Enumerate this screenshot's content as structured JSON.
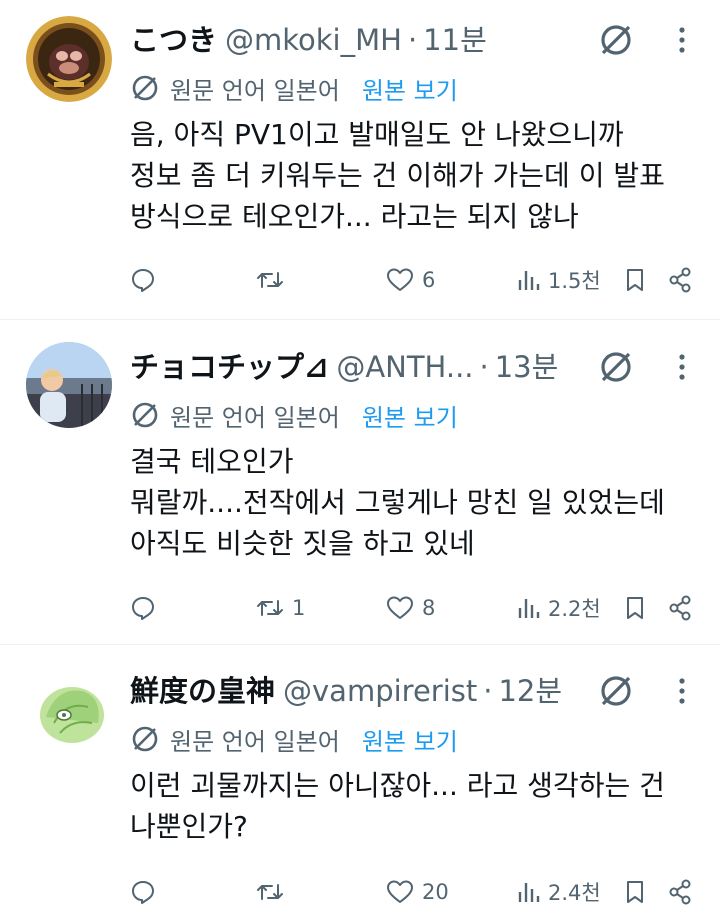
{
  "tweets": [
    {
      "name": "こつき",
      "handle": "@mkoki_MH",
      "separator": "·",
      "time": "11분",
      "translate_label": "원문 언어 일본어",
      "view_original": "원본 보기",
      "text": "음, 아직 PV1이고 발매일도 안 나왔으니까\n정보 좀 더 키워두는 건 이해가 가는데 이 발표\n방식으로 테오인가... 라고는 되지 않나",
      "reply_count": "",
      "retweet_count": "",
      "like_count": "6",
      "view_count": "1.5천",
      "avatar_icon": "guild-emblem-avatar"
    },
    {
      "name": "チョコチップ⊿",
      "handle": "@ANTH...",
      "separator": "·",
      "time": "13분",
      "translate_label": "원문 언어 일본어",
      "view_original": "원본 보기",
      "text": "결국 테오인가\n뭐랄까....전작에서 그렇게나 망친 일 있었는데\n아직도 비슷한 짓을 하고 있네",
      "reply_count": "",
      "retweet_count": "1",
      "like_count": "8",
      "view_count": "2.2천",
      "avatar_icon": "child-photo-avatar"
    },
    {
      "name": "鮮度の皇神",
      "handle": "@vampirerist",
      "separator": "·",
      "time": "12분",
      "translate_label": "원문 언어 일본어",
      "view_original": "원본 보기",
      "text": "이런 괴물까지는 아니잖아... 라고 생각하는 건\n나뿐인가?",
      "reply_count": "",
      "retweet_count": "",
      "like_count": "20",
      "view_count": "2.4천",
      "avatar_icon": "cabbage-character-avatar"
    }
  ],
  "icons": {
    "grok": "grok-slash-icon",
    "more": "more-vertical-icon",
    "translate": "translate-globe-icon",
    "reply": "reply-bubble-icon",
    "retweet": "retweet-icon",
    "like": "heart-icon",
    "views": "views-bar-chart-icon",
    "bookmark": "bookmark-icon",
    "share": "share-icon"
  },
  "colors": {
    "text": "#0f1419",
    "secondary": "#536471",
    "link": "#1d9bf0",
    "divider": "#eff3f4"
  }
}
